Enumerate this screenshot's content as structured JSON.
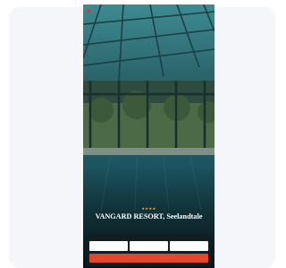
{
  "topbar": {
    "brand": "",
    "links": [
      "",
      ""
    ]
  },
  "hero": {
    "stars": "★★★★",
    "title": "VANGARD RESORT, Seelandtale",
    "subtitle": ""
  },
  "booking": {
    "heading": "",
    "promo": "",
    "fields": [
      {
        "label": "",
        "value": ""
      },
      {
        "label": "",
        "value": ""
      },
      {
        "label": "",
        "value": ""
      }
    ],
    "button": ""
  },
  "colors": {
    "accent": "#e0472d",
    "logo": "#e2372b",
    "stars": "#f1c244",
    "water": "#1d4e59",
    "glass_roof": "#3f8c93"
  },
  "icons": {
    "logo": "brand-logo-icon"
  }
}
